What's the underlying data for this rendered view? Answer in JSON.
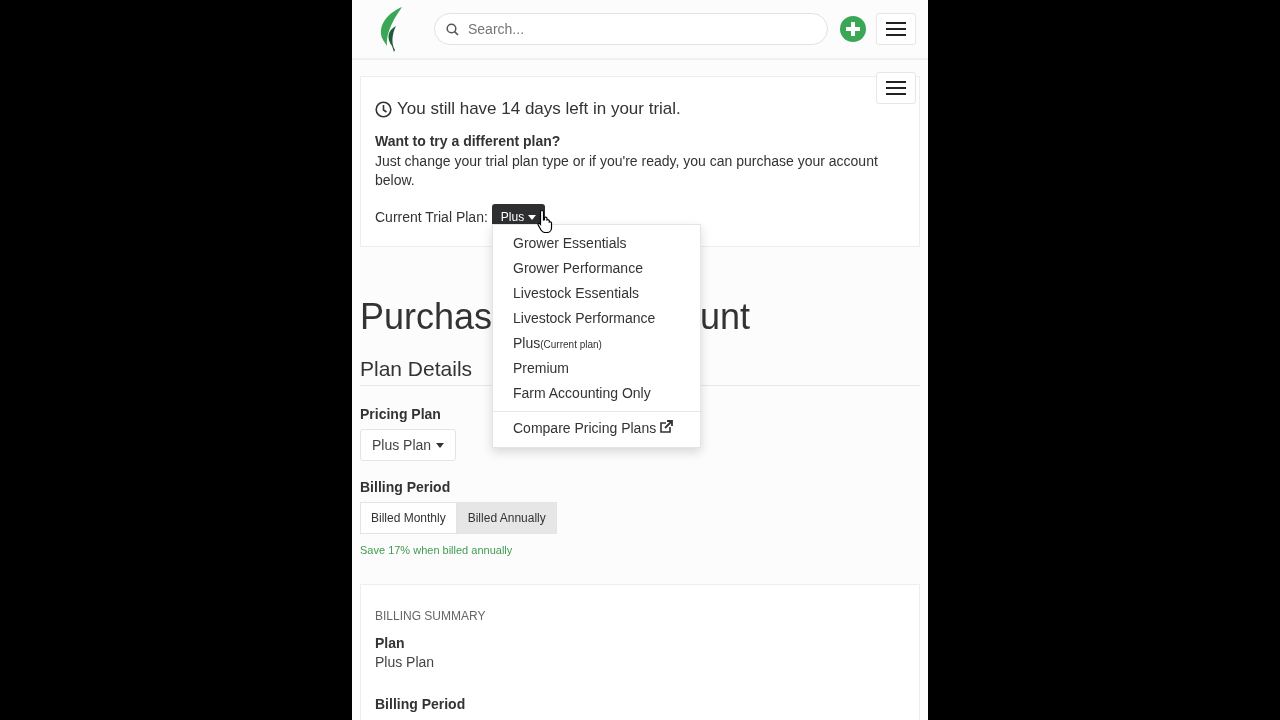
{
  "header": {
    "search": {
      "placeholder": "Search..."
    }
  },
  "trial": {
    "title": "You still have 14 days left in your trial.",
    "question": "Want to try a different plan?",
    "text": "Just change your trial plan type or if you're ready, you can purchase your account below.",
    "plan_label": "Current Trial Plan:",
    "plan_button": "Plus",
    "menu": {
      "items": [
        {
          "label": "Grower Essentials"
        },
        {
          "label": "Grower Performance"
        },
        {
          "label": "Livestock Essentials"
        },
        {
          "label": "Livestock Performance"
        },
        {
          "label": "Plus",
          "note": "(Current plan)"
        },
        {
          "label": "Premium"
        },
        {
          "label": "Farm Accounting Only"
        }
      ],
      "footer_link": "Compare Pricing Plans"
    }
  },
  "heading": {
    "left": "Purchas",
    "right": "unt"
  },
  "plan_details": {
    "title": "Plan Details",
    "pricing_label": "Pricing Plan",
    "pricing_value": "Plus Plan",
    "billing_label": "Billing Period",
    "periods": [
      {
        "label": "Billed Monthly",
        "selected": false
      },
      {
        "label": "Billed Annually",
        "selected": true
      }
    ],
    "savings": "Save 17% when billed annually"
  },
  "summary": {
    "title": "BILLING SUMMARY",
    "fields": [
      {
        "label": "Plan",
        "value": "Plus Plan"
      },
      {
        "label": "Billing Period"
      }
    ]
  }
}
